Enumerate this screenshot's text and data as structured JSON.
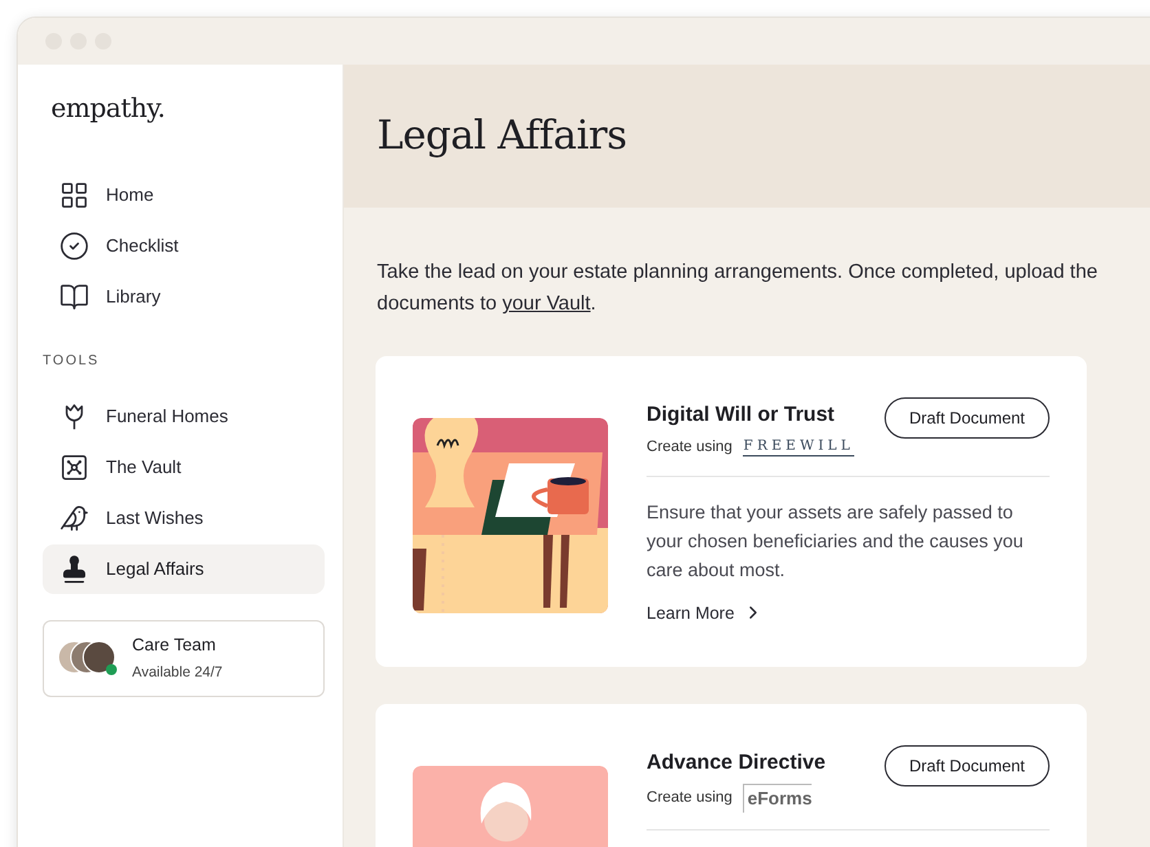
{
  "sidebar": {
    "logo": "empathy.",
    "nav": [
      {
        "label": "Home",
        "selected": false
      },
      {
        "label": "Checklist",
        "selected": false
      },
      {
        "label": "Library",
        "selected": false
      }
    ],
    "section_label": "TOOLS",
    "tools": [
      {
        "label": "Funeral Homes",
        "selected": false
      },
      {
        "label": "The Vault",
        "selected": false
      },
      {
        "label": "Last Wishes",
        "selected": false
      },
      {
        "label": "Legal Affairs",
        "selected": true
      }
    ],
    "care_team": {
      "name": "Care Team",
      "status": "Available 24/7",
      "online": true
    }
  },
  "main": {
    "title": "Legal Affairs",
    "intro": {
      "text": "Take the lead on your estate planning arrangements. Once completed, upload the documents to ",
      "link": "your Vault",
      "end": "."
    },
    "cards": [
      {
        "kind": "will",
        "title": "Digital Will or Trust",
        "provider_prefix": "Create using",
        "provider": "FREEWILL",
        "button": "Draft Document",
        "description": "Ensure that your assets are safely passed to your chosen beneficiaries and the causes you care about most.",
        "link": "Learn More"
      },
      {
        "kind": "directive",
        "title": "Advance Directive",
        "provider_prefix": "Create using",
        "provider": "eForms",
        "button": "Draft Document"
      }
    ]
  }
}
